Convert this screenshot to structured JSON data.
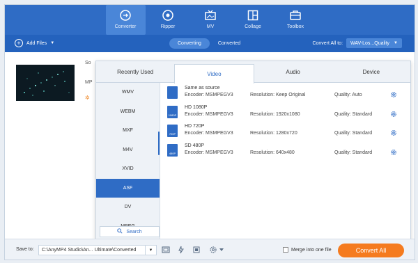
{
  "topnav": {
    "items": [
      {
        "label": "Converter",
        "icon": "converter-icon"
      },
      {
        "label": "Ripper",
        "icon": "ripper-icon"
      },
      {
        "label": "MV",
        "icon": "mv-icon"
      },
      {
        "label": "Collage",
        "icon": "collage-icon"
      },
      {
        "label": "Toolbox",
        "icon": "toolbox-icon"
      }
    ]
  },
  "subbar": {
    "add_files": "Add Files",
    "tabs": [
      "Converting",
      "Converted"
    ],
    "convert_all_label": "Convert All to:",
    "convert_all_value": "WAV-Los...Quality"
  },
  "file": {
    "info1": "So",
    "info2": "MP"
  },
  "format_panel": {
    "tabs": [
      "Recently Used",
      "Video",
      "Audio",
      "Device"
    ],
    "active_tab": "Video",
    "side_items": [
      "WMV",
      "WEBM",
      "MXF",
      "M4V",
      "XVID",
      "ASF",
      "DV",
      "MPEG"
    ],
    "active_side_item": "ASF",
    "search_label": "Search",
    "profiles": [
      {
        "name": "Same as source",
        "badge": "",
        "encoder": "Encoder: MSMPEGV3",
        "resolution": "Resolution: Keep Original",
        "quality": "Quality: Auto"
      },
      {
        "name": "HD 1080P",
        "badge": "1080P",
        "encoder": "Encoder: MSMPEGV3",
        "resolution": "Resolution: 1920x1080",
        "quality": "Quality: Standard"
      },
      {
        "name": "HD 720P",
        "badge": "720P",
        "encoder": "Encoder: MSMPEGV3",
        "resolution": "Resolution: 1280x720",
        "quality": "Quality: Standard"
      },
      {
        "name": "SD 480P",
        "badge": "480P",
        "encoder": "Encoder: MSMPEGV3",
        "resolution": "Resolution: 640x480",
        "quality": "Quality: Standard"
      }
    ]
  },
  "bottombar": {
    "save_to_label": "Save to:",
    "save_path": "C:\\AnyMP4 Studio\\An... Ultimate\\Converted",
    "merge_label": "Merge into one file",
    "convert_button": "Convert All"
  },
  "colors": {
    "primary": "#2f6cc5",
    "accent": "#f57b1f"
  }
}
